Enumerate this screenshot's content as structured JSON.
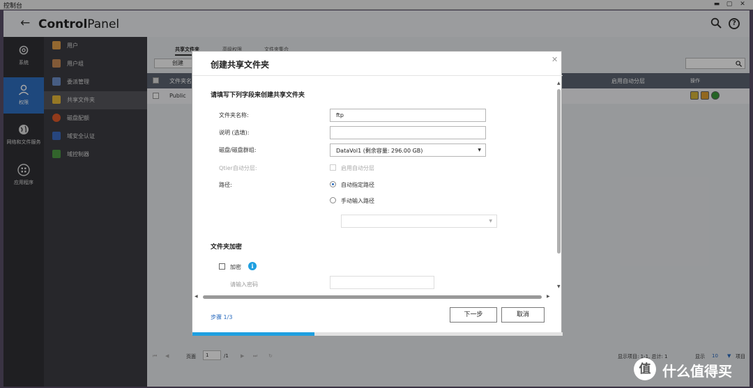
{
  "window": {
    "title": "控制台"
  },
  "header": {
    "title_bold": "Control",
    "title_rest": "Panel"
  },
  "nav_primary": [
    {
      "label": "系统",
      "icon": "gear-icon"
    },
    {
      "label": "权限",
      "icon": "user-icon"
    },
    {
      "label": "网络和文件服务",
      "icon": "globe-icon"
    },
    {
      "label": "应用程序",
      "icon": "apps-grid-icon"
    }
  ],
  "nav_secondary": [
    {
      "label": "用户",
      "color": "#e3a04a"
    },
    {
      "label": "用户组",
      "color": "#c88a55"
    },
    {
      "label": "委派管理",
      "color": "#6d8fc9"
    },
    {
      "label": "共享文件夹",
      "color": "#e6b93a"
    },
    {
      "label": "磁盘配额",
      "color": "#e05a2a"
    },
    {
      "label": "域安全认证",
      "color": "#3c6cc2"
    },
    {
      "label": "域控制器",
      "color": "#4e9a44"
    }
  ],
  "tabs": [
    "共享文件夹",
    "高级权限",
    "文件夹集合"
  ],
  "toolbar": {
    "create_label": "创建"
  },
  "table": {
    "headers": [
      "文件夹名",
      "启用自动分层",
      "操作"
    ],
    "rows": [
      {
        "name": "Public"
      }
    ]
  },
  "footer": {
    "page_label": "页面",
    "page_value": "1",
    "page_total": "/1",
    "items_info": "显示项目: 1-1, 总计: 1",
    "show_label": "显示",
    "per_page": "10",
    "items_label": "项目"
  },
  "dialog": {
    "title": "创建共享文件夹",
    "subtitle": "请填写下列字段来创建共享文件夹",
    "fields": {
      "folder_name_label": "文件夹名称:",
      "folder_name_value": "ftp",
      "desc_label": "说明 (选填):",
      "desc_value": "",
      "volume_label": "磁盘/磁盘群组:",
      "volume_value": "DataVol1 (剩余容量:   296.00 GB)",
      "qtier_label": "Qtier自动分层:",
      "qtier_checkbox_label": "启用自动分层",
      "path_label": "路径:",
      "path_auto_label": "自动指定路径",
      "path_manual_label": "手动输入路径",
      "path_manual_value": ""
    },
    "encryption": {
      "title": "文件夹加密",
      "checkbox_label": "加密",
      "info_icon": "i",
      "password_placeholder": "请输入密码"
    },
    "step": "步骤 1/3",
    "next_label": "下一步",
    "cancel_label": "取消",
    "progress": 0.33
  },
  "watermark": {
    "logo_char": "值",
    "text": "什么值得买"
  },
  "colors": {
    "accent": "#2e6fc0",
    "progress": "#1e9fe0",
    "header_row": "#5c6472"
  }
}
